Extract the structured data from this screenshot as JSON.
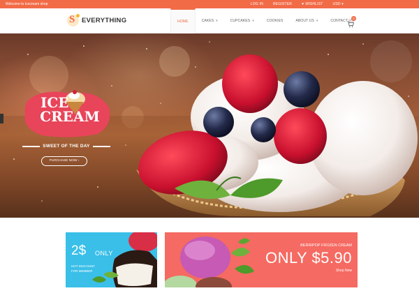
{
  "topbar": {
    "welcome": "Welcome to Icecream shop",
    "login": "LOG IN",
    "register": "REGISTER",
    "wishlist": "WISHLIST",
    "currency": "USD"
  },
  "header": {
    "logo_text": "EVERYTHING",
    "nav": [
      {
        "label": "HOME",
        "has_caret": false
      },
      {
        "label": "CAKES",
        "has_caret": true
      },
      {
        "label": "CUPCAKES",
        "has_caret": true
      },
      {
        "label": "COOKIES",
        "has_caret": false
      },
      {
        "label": "ABOUT US",
        "has_caret": true
      },
      {
        "label": "CONTACT US",
        "has_caret": false
      }
    ],
    "cart_count": "0"
  },
  "hero": {
    "title_line1": "ICE",
    "title_line2": "CREAM",
    "tagline": "SWEET OF THE DAY",
    "button": "PURCHASE NOW"
  },
  "promos": {
    "left": {
      "price": "2$",
      "only": "ONLY",
      "line1": "HOT DISCOUNT",
      "line2": "FOR MEMBER"
    },
    "right": {
      "name": "BERRIPOP FROZEN CREAM",
      "price": "ONLY $5.90",
      "cta": "Shop Now"
    }
  },
  "colors": {
    "accent": "#f26b47",
    "promo_blue": "#39bfe8",
    "promo_red": "#f56a62",
    "badge_pink": "#e8445a"
  }
}
